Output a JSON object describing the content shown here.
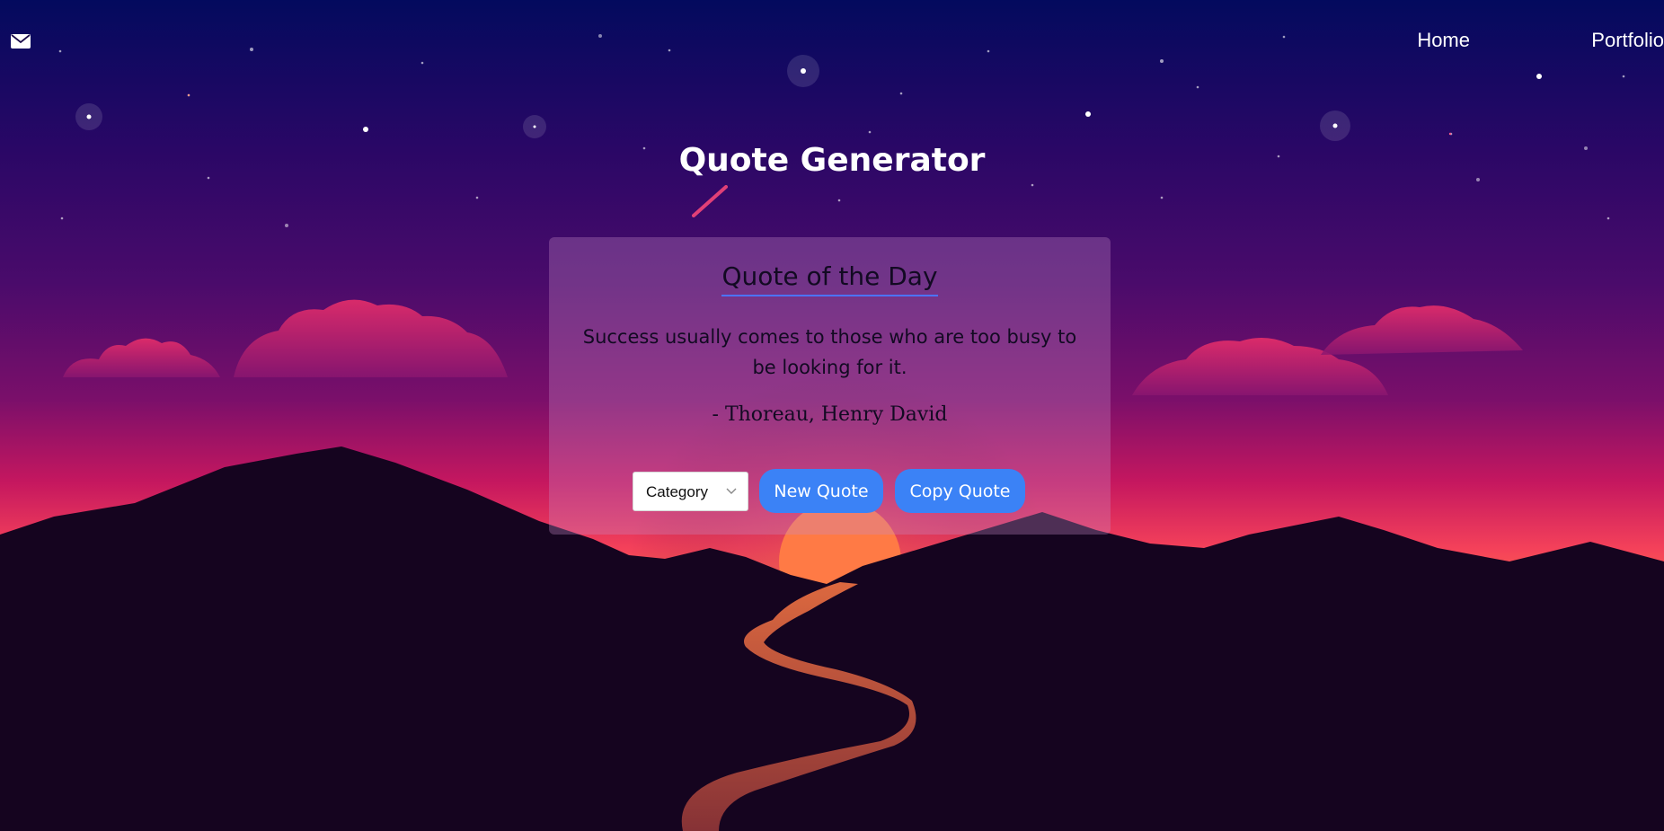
{
  "header": {
    "mail_icon": "envelope-icon",
    "nav": [
      {
        "label": "Home"
      },
      {
        "label": "Portfolio"
      }
    ]
  },
  "main": {
    "title": "Quote Generator",
    "card": {
      "heading": "Quote of the Day",
      "quote": "Success usually comes to those who are too busy to be looking for it.",
      "author": "- Thoreau, Henry David",
      "category_select": {
        "selected": "Category"
      },
      "new_quote_label": "New Quote",
      "copy_quote_label": "Copy Quote"
    }
  },
  "colors": {
    "sky_top": "#030a5e",
    "sky_mid": "#4a0b6b",
    "horizon": "#f0306a",
    "mountain": "#15041f",
    "sun": "#ff7a45",
    "button": "#3b82f6",
    "underline": "#4c73ff"
  }
}
